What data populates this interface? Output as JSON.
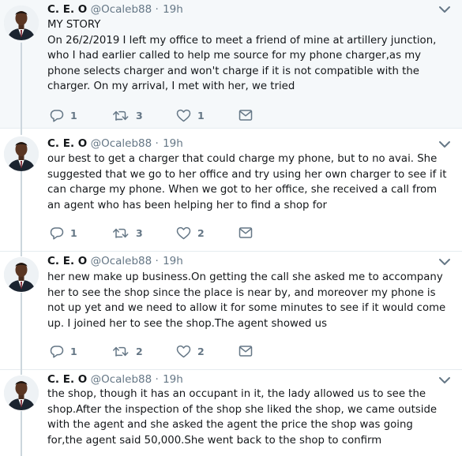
{
  "author": {
    "name": "C. E. O",
    "handle": "@Ocaleb88",
    "separator": "·"
  },
  "tweets": [
    {
      "time": "19h",
      "text": "MY STORY\nOn 26/2/2019 I left my office to meet a friend of mine at artillery junction, who I had earlier called to help me source for my phone charger,as my phone selects charger and won't charge if it is not compatible with the charger. On my arrival, I met with her, we tried",
      "replies": "1",
      "retweets": "3",
      "likes": "1"
    },
    {
      "time": "19h",
      "text": "our best to get a charger that could charge my phone, but to no avai. She suggested that we go to her office and try using her own charger to see if it can charge my phone. When we got to her office, she received a call from an agent who has been helping her to find a shop for",
      "replies": "1",
      "retweets": "3",
      "likes": "2"
    },
    {
      "time": "19h",
      "text": "her new make up business.On getting the call she asked me to accompany her to see the shop since the place is near by, and moreover my phone is not up yet and we need to allow it for some minutes to see if it would come up. I joined her to see the shop.The agent showed us",
      "replies": "1",
      "retweets": "2",
      "likes": "2"
    },
    {
      "time": "19h",
      "text": "the shop, though it has an occupant in it, the lady allowed us to see the shop.After the inspection of the shop she liked the shop, we came outside with the agent and she asked the agent the price the shop was going for,the agent said 50,000.She went back to the shop to confirm"
    }
  ],
  "icons": {
    "reply": "reply-icon",
    "retweet": "retweet-icon",
    "like": "heart-icon",
    "message": "envelope-icon",
    "menu": "chevron-down-icon"
  },
  "colors": {
    "highlight_bg": "#f5f8fa",
    "icon_gray": "#657786",
    "divider": "#e6ecf0",
    "thread_line": "#ccd6dd"
  }
}
